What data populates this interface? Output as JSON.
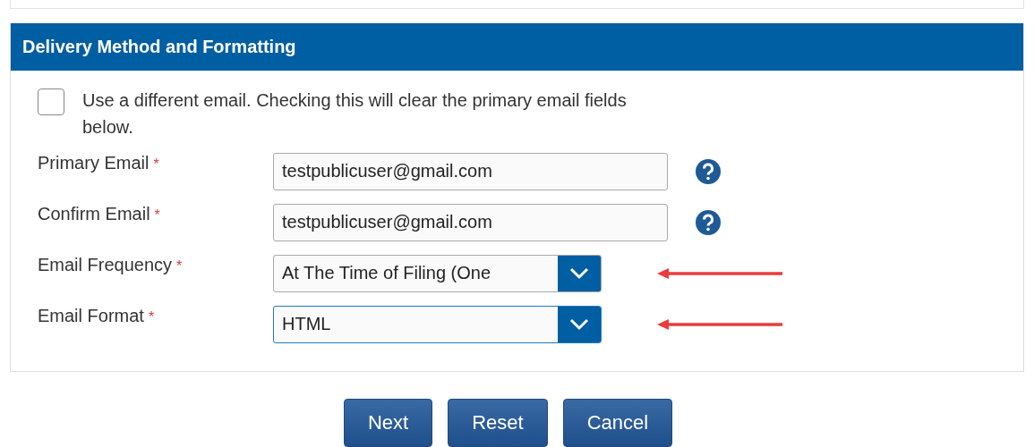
{
  "panel": {
    "title": "Delivery Method and Formatting"
  },
  "checkbox": {
    "label": "Use a different email. Checking this will clear the primary email fields below.",
    "checked": false
  },
  "fields": [
    {
      "kind": "text",
      "label": "Primary Email",
      "required_mark": "*",
      "value": "testpublicuser@gmail.com",
      "help": true,
      "marked": false,
      "focused": false
    },
    {
      "kind": "text",
      "label": "Confirm Email",
      "required_mark": "*",
      "value": "testpublicuser@gmail.com",
      "help": true,
      "marked": false,
      "focused": false
    },
    {
      "kind": "select",
      "label": "Email Frequency",
      "required_mark": "*",
      "value": "At The Time of Filing (One",
      "help": false,
      "marked": true,
      "focused": false
    },
    {
      "kind": "select",
      "label": "Email Format",
      "required_mark": "*",
      "value": "HTML",
      "help": false,
      "marked": true,
      "focused": true
    }
  ],
  "buttons": [
    "Next",
    "Reset",
    "Cancel"
  ]
}
